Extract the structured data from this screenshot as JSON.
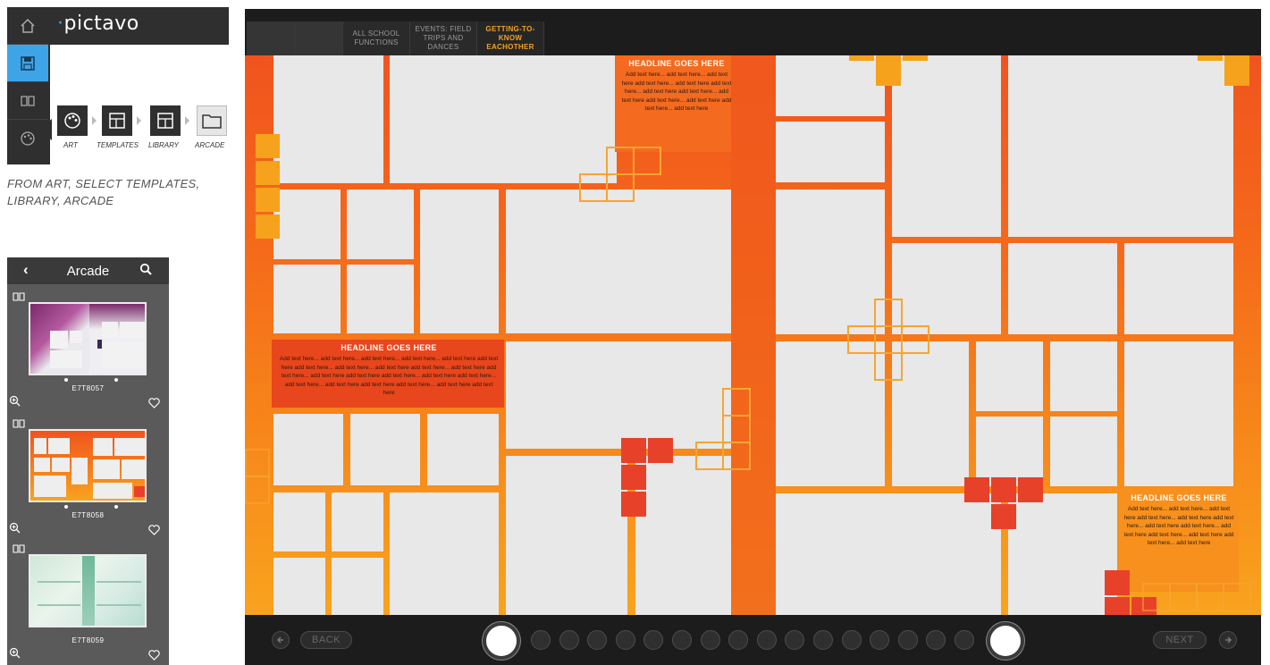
{
  "app": {
    "brand": "pictavo"
  },
  "rail": {
    "items": [
      {
        "icon": "home-icon"
      },
      {
        "icon": "save-icon",
        "active": true
      },
      {
        "icon": "book-icon"
      },
      {
        "icon": "palette-icon"
      }
    ]
  },
  "tools": [
    {
      "label": "ART",
      "icon": "palette-icon"
    },
    {
      "label": "TEMPLATES",
      "icon": "template-icon"
    },
    {
      "label": "LIBRARY",
      "icon": "library-icon"
    },
    {
      "label": "ARCADE",
      "icon": "folder-icon"
    }
  ],
  "instruction": "FROM ART, SELECT TEMPLATES, LIBRARY, ARCADE",
  "arcade": {
    "title": "Arcade",
    "cards": [
      {
        "code": "E7T8057"
      },
      {
        "code": "E7T8058"
      },
      {
        "code": "E7T8059"
      }
    ]
  },
  "editor": {
    "tabs": [
      {
        "label": ""
      },
      {
        "label": ""
      },
      {
        "label": "ALL SCHOOL FUNCTIONS"
      },
      {
        "label": "EVENTS: FIELD TRIPS AND DANCES"
      },
      {
        "label": "GETTING-TO-KNOW EACHOTHER",
        "active": true
      }
    ],
    "headline_1": {
      "title": "HEADLINE GOES HERE",
      "body": "Add text here... add text here... add text here add text here... add text here add text here... add text here add text here... add text here add text here... add text here add text here... add text here"
    },
    "headline_2": {
      "title": "HEADLINE GOES HERE",
      "body": "Add text here... add text here... add text here... add text here... add text here add text here add text here... add text here... add text here add text here... add text here add text here... add text here add text here add text here... add text here add text here... add text here... add text here add text here add text here... add text here add text here"
    },
    "headline_3": {
      "title": "HEADLINE GOES HERE",
      "body": "Add text here... add text here... add text here add text here... add text here add text here... add text here add text here... add text here add text here... add text here add text here... add text here"
    },
    "nav": {
      "back": "BACK",
      "next": "NEXT",
      "page_count": 17,
      "current_left": 0,
      "current_right": 17
    }
  },
  "colors": {
    "accent": "#3ea4e8",
    "orange_dark": "#f0541e",
    "orange_light": "#f9a31e",
    "square_yellow": "#f6a21d",
    "square_red": "#e8412a",
    "tab_active": "#f4a21d"
  }
}
